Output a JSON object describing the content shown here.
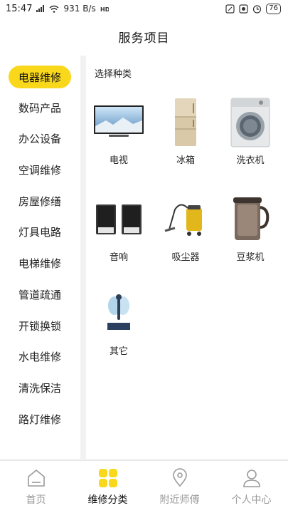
{
  "status_bar": {
    "time": "15:47",
    "network_speed": "931 B/s",
    "battery": "76"
  },
  "header": {
    "title": "服务项目"
  },
  "sidebar": {
    "items": [
      {
        "label": "电器维修",
        "active": true
      },
      {
        "label": "数码产品",
        "active": false
      },
      {
        "label": "办公设备",
        "active": false
      },
      {
        "label": "空调维修",
        "active": false
      },
      {
        "label": "房屋修缮",
        "active": false
      },
      {
        "label": "灯具电路",
        "active": false
      },
      {
        "label": "电梯维修",
        "active": false
      },
      {
        "label": "管道疏通",
        "active": false
      },
      {
        "label": "开锁换锁",
        "active": false
      },
      {
        "label": "水电维修",
        "active": false
      },
      {
        "label": "清洗保洁",
        "active": false
      },
      {
        "label": "路灯维修",
        "active": false
      }
    ]
  },
  "main": {
    "section_title": "选择种类",
    "items": [
      {
        "label": "电视",
        "icon": "tv-icon"
      },
      {
        "label": "冰箱",
        "icon": "fridge-icon"
      },
      {
        "label": "洗衣机",
        "icon": "washing-machine-icon"
      },
      {
        "label": "音响",
        "icon": "speaker-icon"
      },
      {
        "label": "吸尘器",
        "icon": "vacuum-cleaner-icon"
      },
      {
        "label": "豆浆机",
        "icon": "soymilk-maker-icon"
      },
      {
        "label": "其它",
        "icon": "other-icon"
      }
    ]
  },
  "tabbar": {
    "tabs": [
      {
        "label": "首页",
        "active": false,
        "icon": "home-icon"
      },
      {
        "label": "维修分类",
        "active": true,
        "icon": "category-grid-icon"
      },
      {
        "label": "附近师傅",
        "active": false,
        "icon": "location-pin-icon"
      },
      {
        "label": "个人中心",
        "active": false,
        "icon": "person-icon"
      }
    ]
  },
  "colors": {
    "accent": "#f9d81c",
    "background": "#f2f2f2",
    "panel": "#ffffff",
    "inactive_text": "#9a9a9a"
  }
}
